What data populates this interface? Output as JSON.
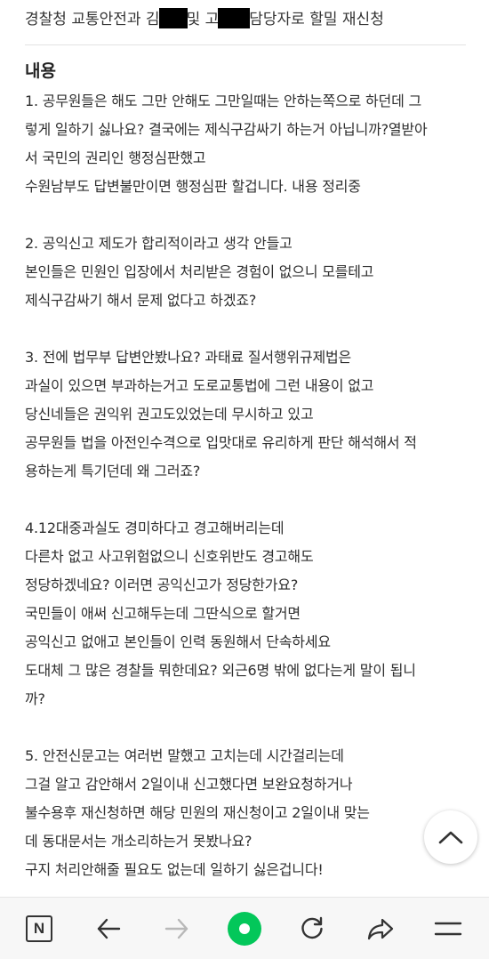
{
  "header": {
    "title_part1": "경찰청 교통안전과 김",
    "title_part2": "및 고",
    "title_part3": "담당자로 할밀 재신청"
  },
  "section": {
    "heading": "내용"
  },
  "content": {
    "lines": [
      "1. 공무원들은 해도 그만 안해도 그만일때는 안하는쪽으로 하던데 그",
      "렇게 일하기 싫나요? 결국에는 제식구감싸기 하는거 아닙니까?열받아",
      "서  국민의 권리인 행정심판했고",
      "수원남부도 답변불만이면 행정심판 할겁니다. 내용 정리중",
      "",
      "2.  공익신고 제도가 합리적이라고 생각 안들고",
      "본인들은 민원인 입장에서 처리받은 경험이 없으니 모를테고",
      "제식구감싸기 해서 문제 없다고 하겠죠?",
      "",
      "3. 전에 법무부 답변안봤나요? 과태료 질서행위규제법은",
      "과실이 있으면 부과하는거고 도로교통법에 그런 내용이 없고",
      "당신네들은 권익위 권고도있었는데 무시하고 있고",
      "공무원들 법을 아전인수격으로 입맛대로 유리하게 판단 해석해서 적",
      "용하는게 특기던데 왜 그러죠?",
      "",
      "4.12대중과실도 경미하다고 경고해버리는데",
      "다른차 없고 사고위험없으니 신호위반도 경고해도",
      "정당하겠네요? 이러면 공익신고가 정당한가요?",
      "국민들이 애써 신고해두는데 그딴식으로 할거면",
      "공익신고 없애고 본인들이 인력 동원해서 단속하세요",
      "도대체  그 많은 경찰들 뭐한데요? 외근6명 밖에 없다는게 말이 됩니",
      "까?",
      "",
      "5. 안전신문고는 여러번 말했고 고치는데 시간걸리는데",
      "그걸 알고 감안해서 2일이내 신고했다면 보완요청하거나",
      "불수용후 재신청하면 해당 민원의 재신청이고 2일이내 맞는",
      "데 동대문서는 개소리하는거 못봤나요?",
      "구지 처리안해줄 필요도 없는데 일하기 싫은겁니다!"
    ]
  },
  "toolbar": {
    "home_label": "N",
    "icons": [
      "naver-home-icon",
      "back-arrow-icon",
      "forward-arrow-icon",
      "green-dot-icon",
      "refresh-icon",
      "share-icon",
      "menu-icon"
    ]
  },
  "scroll_top": {
    "icon": "chevron-up-icon"
  },
  "colors": {
    "accent_green": "#03c75a",
    "text": "#2e2e2e",
    "disabled": "#b8b8b8"
  }
}
